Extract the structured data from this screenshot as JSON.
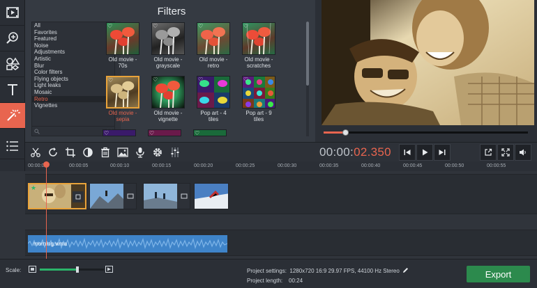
{
  "sidebar": {
    "tools": [
      {
        "name": "media-import-tool",
        "icon": "film-icon"
      },
      {
        "name": "zoom-tool",
        "icon": "zoom-in-icon"
      },
      {
        "name": "stickers-tool",
        "icon": "shapes-icon"
      },
      {
        "name": "titles-tool",
        "icon": "text-icon"
      },
      {
        "name": "filters-tool",
        "icon": "magic-wand-icon"
      },
      {
        "name": "more-tool",
        "icon": "menu-icon"
      }
    ]
  },
  "filters": {
    "title": "Filters",
    "categories": [
      "All",
      "Favorites",
      "Featured",
      "Noise",
      "Adjustments",
      "Artistic",
      "Blur",
      "Color filters",
      "Flying objects",
      "Light leaks",
      "Mosaic",
      "Retro",
      "Vignettes"
    ],
    "selected_category": "Retro",
    "thumbnails": [
      {
        "line1": "Old movie -",
        "line2": "70s"
      },
      {
        "line1": "Old movie -",
        "line2": "grayscale"
      },
      {
        "line1": "Old movie -",
        "line2": "retro"
      },
      {
        "line1": "Old movie -",
        "line2": "scratches"
      },
      {
        "line1": "Old movie -",
        "line2": "sepia"
      },
      {
        "line1": "Old movie -",
        "line2": "vignette"
      },
      {
        "line1": "Pop art - 4",
        "line2": "tiles"
      },
      {
        "line1": "Pop art - 9",
        "line2": "tiles"
      }
    ],
    "collapse_arrow": "‹"
  },
  "player": {
    "timecode_main": "00:00:",
    "timecode_red": "02.350"
  },
  "timeline": {
    "ticks": [
      "00:00:00",
      "00:00:05",
      "00:00:10",
      "00:00:15",
      "00:00:20",
      "00:00:25",
      "00:00:30",
      "00:00:35",
      "00:00:40",
      "00:00:45",
      "00:00:50",
      "00:00:55"
    ],
    "audio_clip": "morning.wma"
  },
  "status": {
    "scale_label": "Scale:",
    "settings_label": "Project settings:",
    "settings_value": "1280x720 16:9 29.97 FPS, 44100 Hz Stereo",
    "length_label": "Project length:",
    "length_value": "00:24",
    "export_label": "Export"
  },
  "colors": {
    "accent": "#e8654f",
    "export": "#2c8a4d",
    "audio": "#3f84c9",
    "selection": "#e9a33a"
  }
}
